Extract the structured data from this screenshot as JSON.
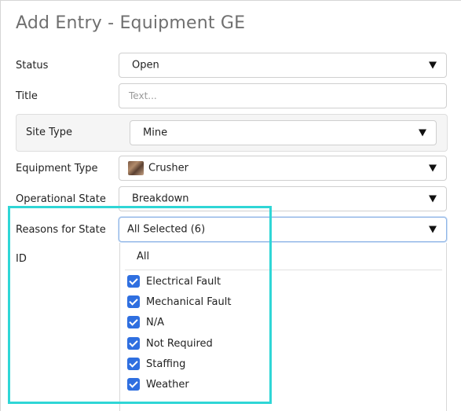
{
  "page": {
    "title": "Add Entry - Equipment GE"
  },
  "form": {
    "status": {
      "label": "Status",
      "value": "Open"
    },
    "title": {
      "label": "Title",
      "placeholder": "Text..."
    },
    "site_type": {
      "label": "Site Type",
      "value": "Mine"
    },
    "equipment_type": {
      "label": "Equipment Type",
      "value": "Crusher",
      "thumbnail_icon": "crusher-thumbnail"
    },
    "operational_state": {
      "label": "Operational State",
      "value": "Breakdown"
    },
    "reasons_for_state": {
      "label": "Reasons for State",
      "value": "All Selected (6)"
    },
    "id": {
      "label": "ID"
    }
  },
  "reasons_dropdown": {
    "all_label": "All",
    "options": [
      {
        "label": "Electrical Fault",
        "checked": true
      },
      {
        "label": "Mechanical Fault",
        "checked": true
      },
      {
        "label": "N/A",
        "checked": true
      },
      {
        "label": "Not Required",
        "checked": true
      },
      {
        "label": "Staffing",
        "checked": true
      },
      {
        "label": "Weather",
        "checked": true
      }
    ]
  },
  "colors": {
    "checkbox": "#2f6fe0",
    "highlight": "#2fd6d6",
    "title": "#6f6f6f"
  }
}
